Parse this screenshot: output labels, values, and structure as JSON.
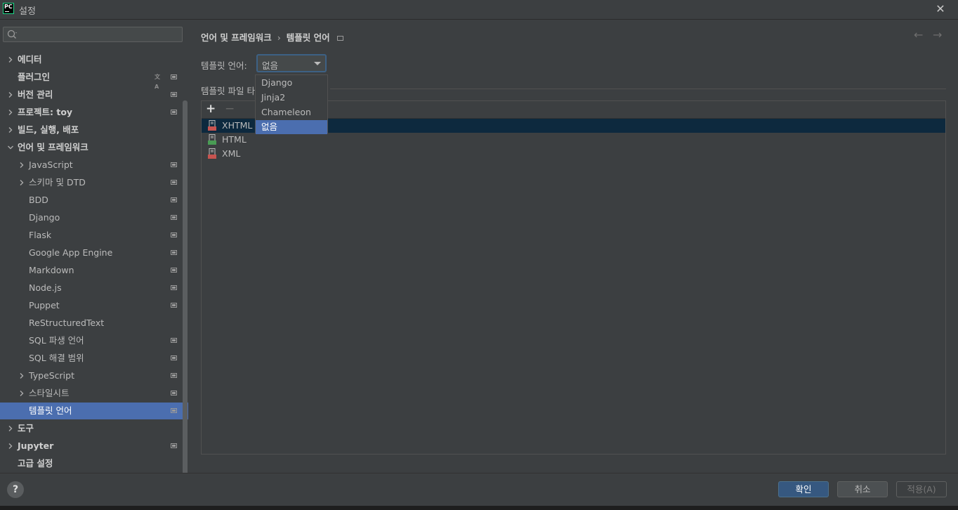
{
  "window": {
    "title": "설정",
    "app_icon_text": "PC"
  },
  "sidebar": {
    "search_placeholder": "",
    "items": [
      {
        "label": "에디터",
        "bold": true,
        "expand": "collapsed",
        "indent": 0,
        "mini": false
      },
      {
        "label": "플러그인",
        "bold": true,
        "expand": "none",
        "indent": 0,
        "mini": true,
        "translate": true
      },
      {
        "label": "버전 관리",
        "bold": true,
        "expand": "collapsed",
        "indent": 0,
        "mini": true
      },
      {
        "label": "프로젝트: toy",
        "bold": true,
        "expand": "collapsed",
        "indent": 0,
        "mini": true
      },
      {
        "label": "빌드, 실행, 배포",
        "bold": true,
        "expand": "collapsed",
        "indent": 0,
        "mini": false
      },
      {
        "label": "언어 및 프레임워크",
        "bold": true,
        "expand": "expanded",
        "indent": 0,
        "mini": false
      },
      {
        "label": "JavaScript",
        "bold": false,
        "expand": "collapsed",
        "indent": 1,
        "mini": true
      },
      {
        "label": "스키마 및 DTD",
        "bold": false,
        "expand": "collapsed",
        "indent": 1,
        "mini": true
      },
      {
        "label": "BDD",
        "bold": false,
        "expand": "none",
        "indent": 1,
        "mini": true
      },
      {
        "label": "Django",
        "bold": false,
        "expand": "none",
        "indent": 1,
        "mini": true
      },
      {
        "label": "Flask",
        "bold": false,
        "expand": "none",
        "indent": 1,
        "mini": true
      },
      {
        "label": "Google App Engine",
        "bold": false,
        "expand": "none",
        "indent": 1,
        "mini": true
      },
      {
        "label": "Markdown",
        "bold": false,
        "expand": "none",
        "indent": 1,
        "mini": true
      },
      {
        "label": "Node.js",
        "bold": false,
        "expand": "none",
        "indent": 1,
        "mini": true
      },
      {
        "label": "Puppet",
        "bold": false,
        "expand": "none",
        "indent": 1,
        "mini": true
      },
      {
        "label": "ReStructuredText",
        "bold": false,
        "expand": "none",
        "indent": 1,
        "mini": false
      },
      {
        "label": "SQL 파생 언어",
        "bold": false,
        "expand": "none",
        "indent": 1,
        "mini": true
      },
      {
        "label": "SQL 해결 범위",
        "bold": false,
        "expand": "none",
        "indent": 1,
        "mini": true
      },
      {
        "label": "TypeScript",
        "bold": false,
        "expand": "collapsed",
        "indent": 1,
        "mini": true
      },
      {
        "label": "스타일시트",
        "bold": false,
        "expand": "collapsed",
        "indent": 1,
        "mini": true
      },
      {
        "label": "템플릿 언어",
        "bold": false,
        "expand": "none",
        "indent": 1,
        "mini": true,
        "selected": true
      },
      {
        "label": "도구",
        "bold": true,
        "expand": "collapsed",
        "indent": 0,
        "mini": false
      },
      {
        "label": "Jupyter",
        "bold": true,
        "expand": "collapsed",
        "indent": 0,
        "mini": true
      },
      {
        "label": "고급 설정",
        "bold": true,
        "expand": "none",
        "indent": 0,
        "mini": false
      }
    ]
  },
  "main": {
    "breadcrumb": [
      "언어 및 프레임워크",
      "템플릿 언어"
    ],
    "breadcrumb_separator": "›",
    "field_label": "템플릿 언어:",
    "combo_value": "없음",
    "section_label": "템플릿 파일 타",
    "toolbar": {
      "add": "+",
      "remove": "−"
    },
    "file_types": [
      {
        "label": "XHTML",
        "icon": "xhtml-file-icon",
        "badge": "#c75450",
        "selected": true
      },
      {
        "label": "HTML",
        "icon": "html-file-icon",
        "badge": "#499c54",
        "selected": false
      },
      {
        "label": "XML",
        "icon": "xml-file-icon",
        "badge": "#c75450",
        "selected": false
      }
    ],
    "dropdown_options": [
      "Django",
      "Jinja2",
      "Chameleon",
      "없음"
    ],
    "dropdown_selected_index": 3
  },
  "footer": {
    "help": "?",
    "ok": "확인",
    "cancel": "취소",
    "apply": "적용(A)"
  },
  "colors": {
    "accent": "#4b6eaf",
    "ok_button": "#365880",
    "background": "#3c3f41",
    "list_selection": "#0d293e"
  }
}
